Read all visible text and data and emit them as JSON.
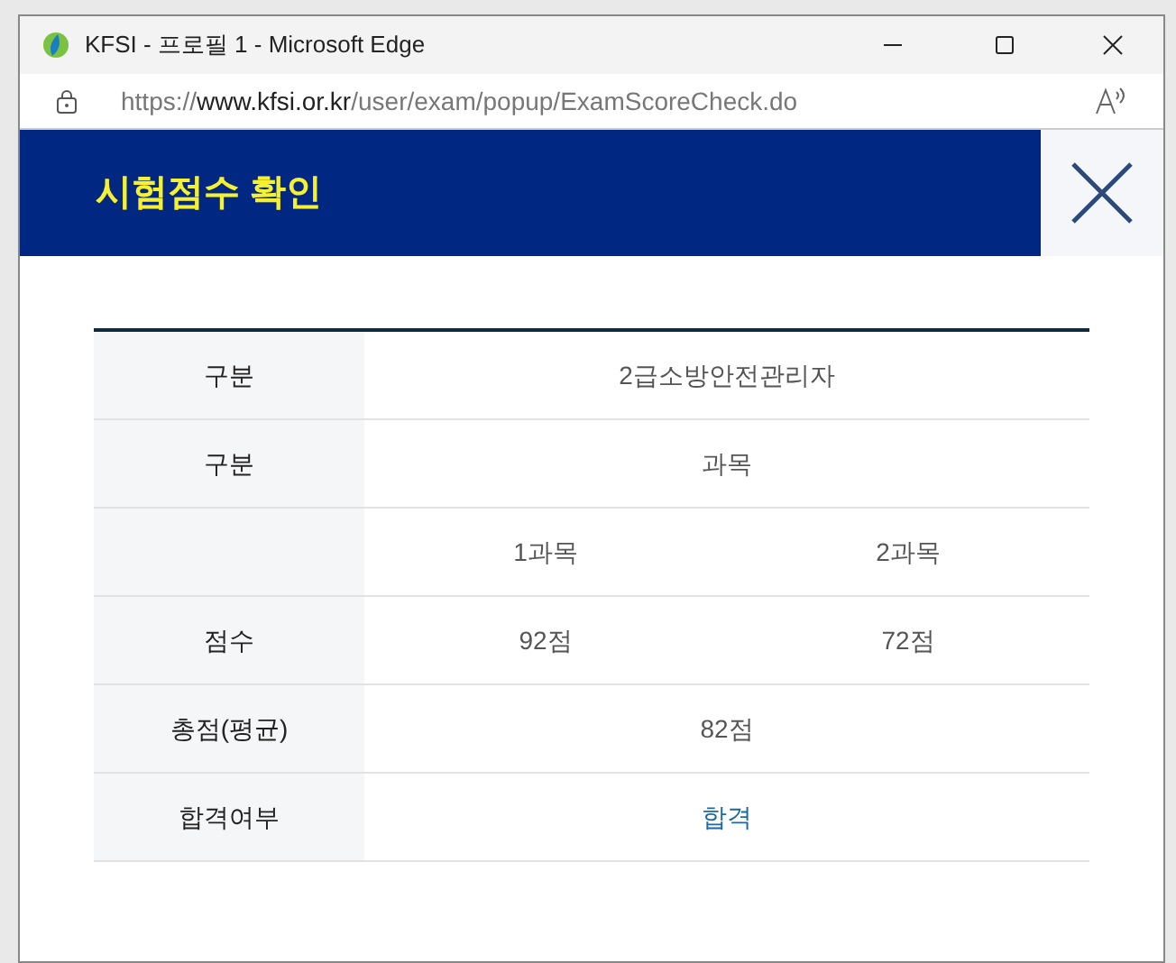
{
  "window": {
    "title": "KFSI - 프로필 1 - Microsoft Edge"
  },
  "address_bar": {
    "scheme": "https://",
    "host": "www.kfsi.or.kr",
    "path": "/user/exam/popup/ExamScoreCheck.do"
  },
  "popup": {
    "title": "시험점수 확인"
  },
  "table": {
    "rows": [
      {
        "label": "구분",
        "cells": [
          "2급소방안전관리자"
        ]
      },
      {
        "label": "구분",
        "cells": [
          "과목"
        ]
      },
      {
        "label": "",
        "cells": [
          "1과목",
          "2과목"
        ]
      },
      {
        "label": "점수",
        "cells": [
          "92점",
          "72점"
        ]
      },
      {
        "label": "총점(평균)",
        "cells": [
          "82점"
        ]
      },
      {
        "label": "합격여부",
        "cells": [
          "합격"
        ],
        "kind": "result"
      }
    ]
  }
}
